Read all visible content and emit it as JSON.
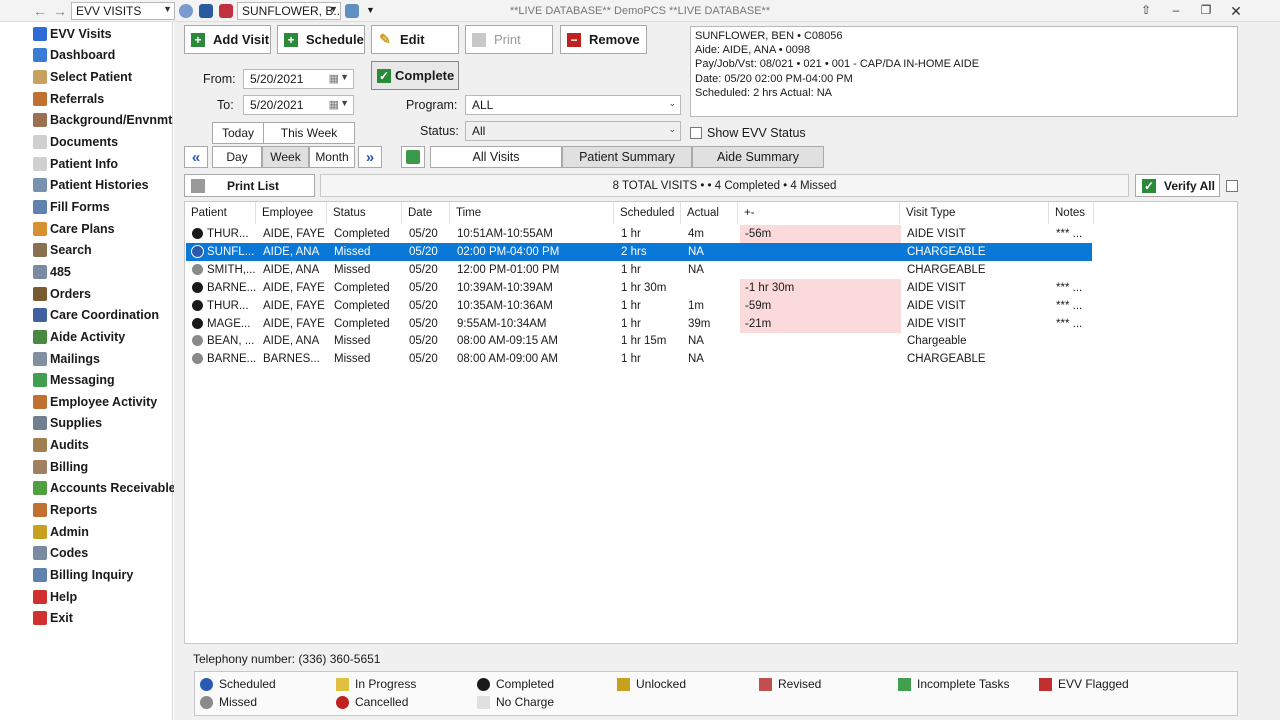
{
  "titlebar": {
    "module_combo": "EVV VISITS",
    "patient_combo": "SUNFLOWER, B...",
    "window_title": "**LIVE DATABASE** DemoPCS **LIVE DATABASE**"
  },
  "sidebar": {
    "items": [
      {
        "label": "EVV Visits",
        "icon": "evv-icon",
        "color": "#2d6bd6"
      },
      {
        "label": "Dashboard",
        "icon": "dashboard-icon",
        "color": "#3a7bd5"
      },
      {
        "label": "Select Patient",
        "icon": "person-icon",
        "color": "#c8a060"
      },
      {
        "label": "Referrals",
        "icon": "referrals-icon",
        "color": "#c07030"
      },
      {
        "label": "Background/Envnmt",
        "icon": "background-icon",
        "color": "#9a7050"
      },
      {
        "label": "Documents",
        "icon": "document-icon",
        "color": "#d0d0d0"
      },
      {
        "label": "Patient Info",
        "icon": "info-icon",
        "color": "#d0d0d0"
      },
      {
        "label": "Patient Histories",
        "icon": "histories-icon",
        "color": "#7a90b0"
      },
      {
        "label": "Fill Forms",
        "icon": "forms-icon",
        "color": "#6080b0"
      },
      {
        "label": "Care Plans",
        "icon": "careplan-icon",
        "color": "#d89030"
      },
      {
        "label": "Search",
        "icon": "search-icon",
        "color": "#8a7050"
      },
      {
        "label": "485",
        "icon": "form485-icon",
        "color": "#7a8aa0"
      },
      {
        "label": "Orders",
        "icon": "orders-icon",
        "color": "#7a5a30"
      },
      {
        "label": "Care Coordination",
        "icon": "coordination-icon",
        "color": "#4060a0"
      },
      {
        "label": "Aide Activity",
        "icon": "aide-activity-icon",
        "color": "#4a8a40"
      },
      {
        "label": "Mailings",
        "icon": "mail-icon",
        "color": "#8090a0"
      },
      {
        "label": "Messaging",
        "icon": "messaging-icon",
        "color": "#40a050"
      },
      {
        "label": "Employee Activity",
        "icon": "employee-icon",
        "color": "#c07030"
      },
      {
        "label": "Supplies",
        "icon": "supplies-icon",
        "color": "#708090"
      },
      {
        "label": "Audits",
        "icon": "audit-icon",
        "color": "#a08050"
      },
      {
        "label": "Billing",
        "icon": "billing-icon",
        "color": "#a08060"
      },
      {
        "label": "Accounts Receivable",
        "icon": "accounts-icon",
        "color": "#50a040"
      },
      {
        "label": "Reports",
        "icon": "reports-icon",
        "color": "#c07030"
      },
      {
        "label": "Admin",
        "icon": "lock-icon",
        "color": "#c8a020"
      },
      {
        "label": "Codes",
        "icon": "codes-icon",
        "color": "#7a8aa0"
      },
      {
        "label": "Billing Inquiry",
        "icon": "inquiry-icon",
        "color": "#6080b0"
      },
      {
        "label": "Help",
        "icon": "help-icon",
        "color": "#d03030"
      },
      {
        "label": "Exit",
        "icon": "exit-icon",
        "color": "#d03030"
      }
    ]
  },
  "toolbar": {
    "add_visit": "Add Visit",
    "schedule": "Schedule",
    "edit": "Edit",
    "print": "Print",
    "remove": "Remove",
    "complete": "Complete"
  },
  "filters": {
    "from_label": "From:",
    "from_value": "5/20/2021",
    "to_label": "To:",
    "to_value": "5/20/2021",
    "program_label": "Program:",
    "program_value": "ALL",
    "status_label": "Status:",
    "status_value": "All",
    "today": "Today",
    "this_week": "This Week",
    "day": "Day",
    "week": "Week",
    "month": "Month",
    "show_evv_status": "Show EVV Status"
  },
  "tabs": {
    "all_visits": "All Visits",
    "patient_summary": "Patient Summary",
    "aide_summary": "Aide Summary"
  },
  "info": {
    "line1": "SUNFLOWER, BEN • C08056",
    "line2": "Aide: AIDE, ANA • 0098",
    "line3": "Pay/Job/Vst: 08/021 • 021 • 001 - CAP/DA IN-HOME AIDE",
    "line4": "Date: 05/20 02:00 PM-04:00 PM",
    "line5": "Scheduled: 2 hrs   Actual: NA"
  },
  "summary": {
    "print_list": "Print List",
    "totals": "8 TOTAL VISITS •  • 4 Completed • 4 Missed",
    "verify_all": "Verify All"
  },
  "grid": {
    "columns": [
      "Patient",
      "Employee",
      "Status",
      "Date",
      "Time",
      "Scheduled",
      "Actual",
      "+-",
      "Visit Type",
      "Notes"
    ],
    "rows": [
      {
        "status_icon": "completed",
        "patient": "THUR...",
        "employee": "AIDE, FAYE",
        "status": "Completed",
        "date": "05/20",
        "time": "10:51AM-10:55AM",
        "scheduled": "1 hr",
        "actual": "4m",
        "diff": "-56m",
        "visit_type": "AIDE VISIT",
        "notes": "*** ...",
        "selected": false
      },
      {
        "status_icon": "scheduled",
        "patient": "SUNFL...",
        "employee": "AIDE, ANA",
        "status": "Missed",
        "date": "05/20",
        "time": "02:00 PM-04:00 PM",
        "scheduled": "2 hrs",
        "actual": "NA",
        "diff": "",
        "visit_type": "CHARGEABLE",
        "notes": "",
        "selected": true
      },
      {
        "status_icon": "missed",
        "patient": "SMITH,...",
        "employee": "AIDE, ANA",
        "status": "Missed",
        "date": "05/20",
        "time": "12:00 PM-01:00 PM",
        "scheduled": "1 hr",
        "actual": "NA",
        "diff": "",
        "visit_type": "CHARGEABLE",
        "notes": "",
        "selected": false
      },
      {
        "status_icon": "completed",
        "patient": "BARNE...",
        "employee": "AIDE, FAYE",
        "status": "Completed",
        "date": "05/20",
        "time": "10:39AM-10:39AM",
        "scheduled": "1 hr 30m",
        "actual": "",
        "diff": "-1 hr 30m",
        "visit_type": "AIDE VISIT",
        "notes": "*** ...",
        "selected": false
      },
      {
        "status_icon": "completed",
        "patient": "THUR...",
        "employee": "AIDE, FAYE",
        "status": "Completed",
        "date": "05/20",
        "time": "10:35AM-10:36AM",
        "scheduled": "1 hr",
        "actual": "1m",
        "diff": "-59m",
        "visit_type": "AIDE VISIT",
        "notes": "*** ...",
        "selected": false
      },
      {
        "status_icon": "completed",
        "patient": "MAGE...",
        "employee": "AIDE, FAYE",
        "status": "Completed",
        "date": "05/20",
        "time": "9:55AM-10:34AM",
        "scheduled": "1 hr",
        "actual": "39m",
        "diff": "-21m",
        "visit_type": "AIDE VISIT",
        "notes": "*** ...",
        "selected": false
      },
      {
        "status_icon": "missed",
        "patient": "BEAN, ...",
        "employee": "AIDE, ANA",
        "status": "Missed",
        "date": "05/20",
        "time": "08:00 AM-09:15 AM",
        "scheduled": "1 hr 15m",
        "actual": "NA",
        "diff": "",
        "visit_type": "Chargeable",
        "notes": "",
        "selected": false
      },
      {
        "status_icon": "missed",
        "patient": "BARNE...",
        "employee": "BARNES...",
        "status": "Missed",
        "date": "05/20",
        "time": "08:00 AM-09:00 AM",
        "scheduled": "1 hr",
        "actual": "NA",
        "diff": "",
        "visit_type": "CHARGEABLE",
        "notes": "",
        "selected": false
      }
    ]
  },
  "telephony": "Telephony number: (336) 360-5651",
  "legend": [
    {
      "label": "Scheduled",
      "icon": "scheduled-icon"
    },
    {
      "label": "In Progress",
      "icon": "in-progress-icon"
    },
    {
      "label": "Completed",
      "icon": "completed-icon"
    },
    {
      "label": "Unlocked",
      "icon": "unlocked-icon"
    },
    {
      "label": "Revised",
      "icon": "revised-icon"
    },
    {
      "label": "Incomplete Tasks",
      "icon": "incomplete-tasks-icon"
    },
    {
      "label": "EVV Flagged",
      "icon": "evv-flagged-icon"
    },
    {
      "label": "Missed",
      "icon": "missed-icon"
    },
    {
      "label": "Cancelled",
      "icon": "cancelled-icon"
    },
    {
      "label": "No Charge",
      "icon": "no-charge-icon"
    }
  ]
}
